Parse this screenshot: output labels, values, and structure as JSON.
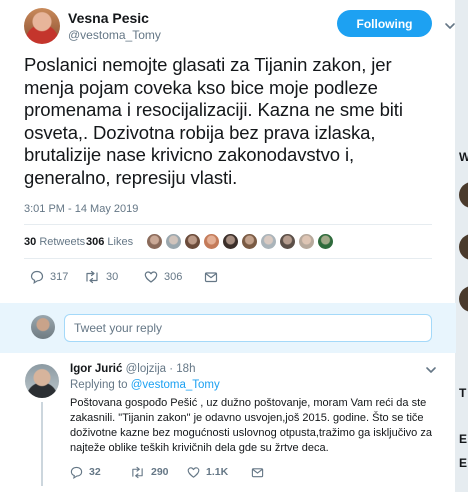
{
  "tweet": {
    "author_name": "Vesna Pesic",
    "author_handle": "@vestoma_Tomy",
    "follow_label": "Following",
    "text": "Poslanici nemojte glasati za Tijanin zakon, jer menja pojam coveka kso bice moje podleze promenama i resocijalizaciji. Kazna ne sme biti osveta,. Dozivotna robija bez prava izlaska, brutalizije nase krivicno zakonodavstvo i, generalno, represiju vlasti.",
    "timestamp": "3:01 PM - 14 May 2019",
    "retweets_count": "30",
    "retweets_label": "Retweets",
    "likes_count": "306",
    "likes_label": "Likes",
    "actions": {
      "replies": "317",
      "retweets": "30",
      "likes": "306"
    },
    "likers_colors": [
      "#8a6a5a",
      "#9aa7ae",
      "#6b4b3a",
      "#c47b5a",
      "#3b2f2a",
      "#7a5b44",
      "#aab4ba",
      "#5b4f48",
      "#b7a99c",
      "#2f6b3c"
    ]
  },
  "composer": {
    "placeholder": "Tweet your reply"
  },
  "reply": {
    "name": "Igor Jurić",
    "handle": "@lojzija",
    "time": "· 18h",
    "replying_prefix": "Replying to",
    "replying_to": "@vestoma_Tomy",
    "lines": [
      "Poštovana gospođo Pešić , uz dužno poštovanje, moram Vam reći da ste",
      "zakasnili. \"Tijanin zakon\" je odavno usvojen,još 2015. godine. Što se tiče",
      "doživotne kazne bez mogućnosti uslovnog otpusta,tražimo ga isključivo za",
      "najteže oblike teških krivičnih dela gde su žrtve deca."
    ],
    "actions": {
      "replies": "32",
      "retweets": "290",
      "likes": "1.1K"
    }
  },
  "background": {
    "letters": [
      "W",
      "T",
      "E",
      "E"
    ]
  },
  "colors": {
    "accent": "#1da1f2",
    "text": "#14171a",
    "secondary": "#657786",
    "composer_bg": "#e8f5fd"
  }
}
